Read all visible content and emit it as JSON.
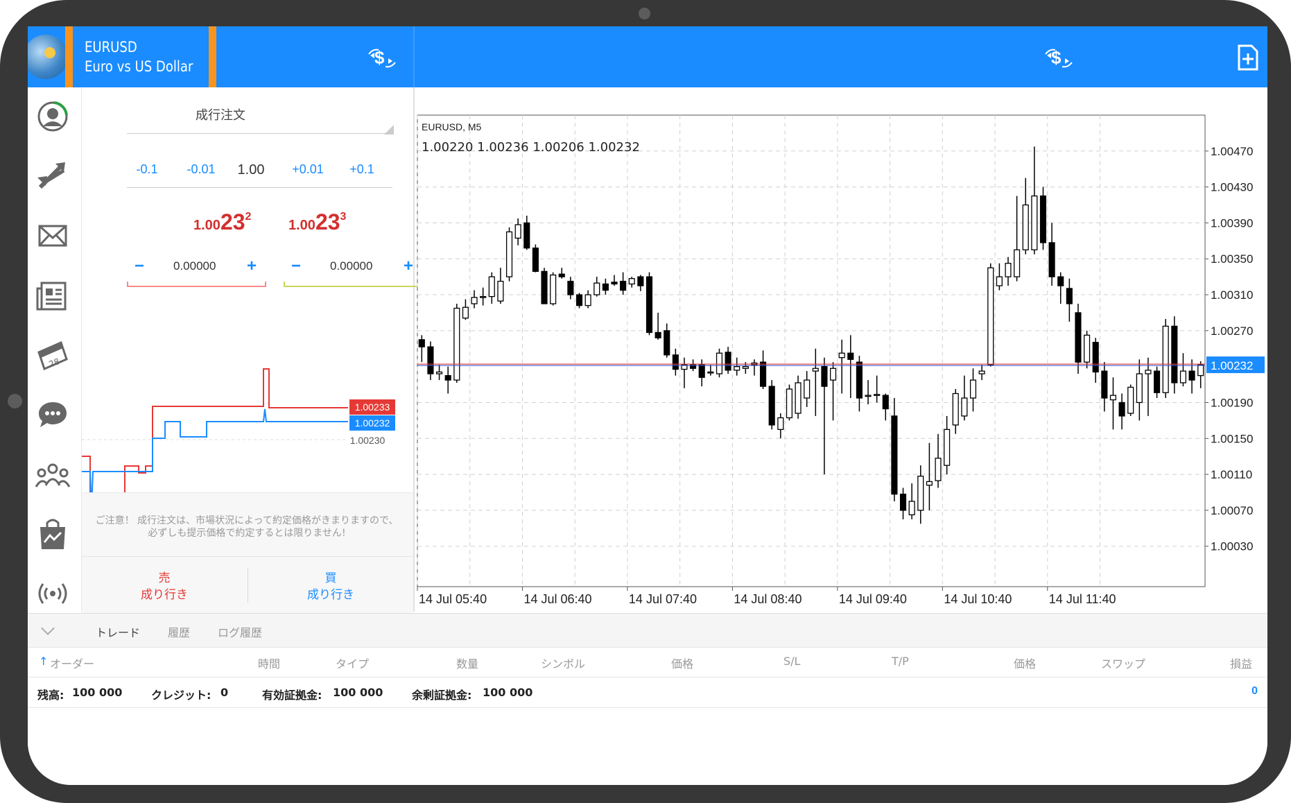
{
  "header": {
    "symbol": "EURUSD",
    "description": "Euro vs US Dollar",
    "icons": [
      "metatrader-app-icon",
      "currency-exchange-icon",
      "currency-exchange-icon",
      "new-order-icon"
    ]
  },
  "sidebar": {
    "items": [
      {
        "icon": "account-icon"
      },
      {
        "icon": "trade-arrows-icon"
      },
      {
        "icon": "mail-icon"
      },
      {
        "icon": "news-icon"
      },
      {
        "icon": "calendar-icon"
      },
      {
        "icon": "chat-icon"
      },
      {
        "icon": "community-icon"
      },
      {
        "icon": "market-bag-icon"
      },
      {
        "icon": "signal-icon"
      }
    ]
  },
  "order": {
    "type": "成行注文",
    "lot_steps": [
      "-0.1",
      "-0.01",
      "1.00",
      "+0.01",
      "+0.1"
    ],
    "bid": {
      "prefix": "1.00",
      "big": "23",
      "sup": "2"
    },
    "ask": {
      "prefix": "1.00",
      "big": "23",
      "sup": "3"
    },
    "stop_loss": {
      "minus": "−",
      "value": "0.00000",
      "plus": "+"
    },
    "take_profit": {
      "minus": "−",
      "value": "0.00000",
      "plus": "+"
    },
    "mini_chart": {
      "ask_label": "1.00233",
      "bid_label": "1.00232",
      "grid_label": "1.00230"
    },
    "notice": "ご注意！ 成行注文は、市場状況によって約定価格がきまりますので、必ずしも提示価格で約定するとは限りません!",
    "sell": {
      "line1": "売",
      "line2": "成り行き"
    },
    "buy": {
      "line1": "買",
      "line2": "成り行き"
    }
  },
  "chart_data": {
    "type": "candlestick",
    "symbol_label": "EURUSD, M5",
    "ohlc_label": "1.00220 1.00236 1.00206 1.00232",
    "current_price": "1.00232",
    "y_ticks": [
      "1.00470",
      "1.00430",
      "1.00390",
      "1.00350",
      "1.00310",
      "1.00270",
      "1.00190",
      "1.00150",
      "1.00110",
      "1.00070",
      "1.00030"
    ],
    "x_ticks": [
      "14 Jul 05:40",
      "14 Jul 06:40",
      "14 Jul 07:40",
      "14 Jul 08:40",
      "14 Jul 09:40",
      "14 Jul 10:40",
      "14 Jul 11:40"
    ],
    "ylim": [
      0.99985,
      1.0051
    ],
    "grid": true,
    "candles": [
      [
        1.0026,
        1.00265,
        1.00235,
        1.00252
      ],
      [
        1.00252,
        1.00258,
        1.00215,
        1.00222
      ],
      [
        1.00222,
        1.00232,
        1.00215,
        1.00224
      ],
      [
        1.0022,
        1.0023,
        1.002,
        1.00215
      ],
      [
        1.00215,
        1.003,
        1.00212,
        1.00295
      ],
      [
        1.00284,
        1.00305,
        1.00282,
        1.00296
      ],
      [
        1.003,
        1.00315,
        1.00295,
        1.00307
      ],
      [
        1.00308,
        1.00318,
        1.00298,
        1.00308
      ],
      [
        1.00308,
        1.00335,
        1.003,
        1.0033
      ],
      [
        1.00303,
        1.0034,
        1.003,
        1.00325
      ],
      [
        1.0033,
        1.00385,
        1.00325,
        1.0038
      ],
      [
        1.00373,
        1.00395,
        1.00365,
        1.00388
      ],
      [
        1.0039,
        1.00398,
        1.0036,
        1.00362
      ],
      [
        1.00362,
        1.00366,
        1.00335,
        1.00336
      ],
      [
        1.00336,
        1.0034,
        1.003,
        1.003
      ],
      [
        1.003,
        1.00335,
        1.00298,
        1.00332
      ],
      [
        1.00333,
        1.0034,
        1.00328,
        1.0033
      ],
      [
        1.00325,
        1.0033,
        1.00305,
        1.0031
      ],
      [
        1.0031,
        1.00312,
        1.00295,
        1.00298
      ],
      [
        1.00298,
        1.00315,
        1.00295,
        1.0031
      ],
      [
        1.0031,
        1.0033,
        1.00308,
        1.00323
      ],
      [
        1.00322,
        1.00328,
        1.0031,
        1.00315
      ],
      [
        1.00324,
        1.00332,
        1.0032,
        1.00322
      ],
      [
        1.00325,
        1.00335,
        1.0031,
        1.00315
      ],
      [
        1.00322,
        1.0033,
        1.00318,
        1.00328
      ],
      [
        1.0033,
        1.00332,
        1.00314,
        1.0032
      ],
      [
        1.0033,
        1.00335,
        1.00265,
        1.00268
      ],
      [
        1.00268,
        1.0029,
        1.0026,
        1.00262
      ],
      [
        1.0027,
        1.00278,
        1.0024,
        1.00243
      ],
      [
        1.00243,
        1.0025,
        1.0022,
        1.00227
      ],
      [
        1.00227,
        1.0024,
        1.00206,
        1.00232
      ],
      [
        1.00232,
        1.00238,
        1.00225,
        1.00228
      ],
      [
        1.00232,
        1.00238,
        1.00208,
        1.00218
      ],
      [
        1.00223,
        1.00232,
        1.0022,
        1.00224
      ],
      [
        1.00222,
        1.0025,
        1.00218,
        1.00245
      ],
      [
        1.00246,
        1.00252,
        1.00222,
        1.00226
      ],
      [
        1.00226,
        1.0024,
        1.0022,
        1.0023
      ],
      [
        1.00228,
        1.00235,
        1.00222,
        1.0023
      ],
      [
        1.00232,
        1.00238,
        1.0022,
        1.00234
      ],
      [
        1.00235,
        1.00248,
        1.00205,
        1.00208
      ],
      [
        1.00208,
        1.00215,
        1.0016,
        1.00165
      ],
      [
        1.0016,
        1.00178,
        1.0015,
        1.00173
      ],
      [
        1.00173,
        1.0021,
        1.0017,
        1.00205
      ],
      [
        1.00178,
        1.0022,
        1.00172,
        1.00212
      ],
      [
        1.00195,
        1.00225,
        1.00185,
        1.00215
      ],
      [
        1.00225,
        1.0025,
        1.00175,
        1.00228
      ],
      [
        1.0023,
        1.0024,
        1.0011,
        1.00208
      ],
      [
        1.00215,
        1.00235,
        1.0017,
        1.00228
      ],
      [
        1.0024,
        1.0026,
        1.002,
        1.00245
      ],
      [
        1.00245,
        1.00265,
        1.00195,
        1.00238
      ],
      [
        1.00235,
        1.00242,
        1.0018,
        1.00195
      ],
      [
        1.00198,
        1.00215,
        1.00188,
        1.00198
      ],
      [
        1.00198,
        1.0022,
        1.0019,
        1.00199
      ],
      [
        1.00198,
        1.002,
        1.0017,
        1.00183
      ],
      [
        1.00175,
        1.00195,
        1.0008,
        1.00088
      ],
      [
        1.00088,
        1.00095,
        1.0006,
        1.0007
      ],
      [
        1.00065,
        1.001,
        1.0006,
        1.0008
      ],
      [
        1.0007,
        1.0012,
        1.00055,
        1.00108
      ],
      [
        1.00098,
        1.00145,
        1.0007,
        1.00102
      ],
      [
        1.00103,
        1.00155,
        1.00095,
        1.00128
      ],
      [
        1.0012,
        1.00175,
        1.0011,
        1.0016
      ],
      [
        1.00165,
        1.00205,
        1.00155,
        1.002
      ],
      [
        1.00175,
        1.0022,
        1.0017,
        1.00195
      ],
      [
        1.00195,
        1.00228,
        1.0018,
        1.00215
      ],
      [
        1.00222,
        1.00232,
        1.00215,
        1.00225
      ],
      [
        1.00232,
        1.00345,
        1.0023,
        1.0034
      ],
      [
        1.0032,
        1.00345,
        1.00315,
        1.0033
      ],
      [
        1.0033,
        1.00352,
        1.0032,
        1.00345
      ],
      [
        1.0033,
        1.0042,
        1.00325,
        1.0036
      ],
      [
        1.0036,
        1.0044,
        1.00355,
        1.0041
      ],
      [
        1.0036,
        1.00475,
        1.00355,
        1.0042
      ],
      [
        1.0042,
        1.0043,
        1.0036,
        1.00368
      ],
      [
        1.00368,
        1.0039,
        1.0032,
        1.0033
      ],
      [
        1.0033,
        1.00335,
        1.003,
        1.0032
      ],
      [
        1.00317,
        1.00328,
        1.0028,
        1.003
      ],
      [
        1.0029,
        1.003,
        1.00222,
        1.00235
      ],
      [
        1.00235,
        1.0027,
        1.00228,
        1.00265
      ],
      [
        1.00257,
        1.00262,
        1.00212,
        1.00224
      ],
      [
        1.00225,
        1.00235,
        1.0018,
        1.00195
      ],
      [
        1.00193,
        1.00218,
        1.0016,
        1.00198
      ],
      [
        1.0019,
        1.002,
        1.0016,
        1.00175
      ],
      [
        1.00178,
        1.0021,
        1.00175,
        1.00207
      ],
      [
        1.0019,
        1.00238,
        1.0017,
        1.00222
      ],
      [
        1.00222,
        1.0024,
        1.00175,
        1.00226
      ],
      [
        1.00225,
        1.0023,
        1.00195,
        1.00201
      ],
      [
        1.00201,
        1.00283,
        1.00195,
        1.00275
      ],
      [
        1.00275,
        1.00286,
        1.002,
        1.00212
      ],
      [
        1.00212,
        1.00245,
        1.00208,
        1.00225
      ],
      [
        1.00225,
        1.00238,
        1.002,
        1.00215
      ],
      [
        1.0022,
        1.00236,
        1.00206,
        1.00232
      ]
    ]
  },
  "bottom": {
    "tabs": [
      "トレード",
      "履歴",
      "ログ履歴"
    ],
    "columns": [
      "オーダー",
      "時間",
      "タイプ",
      "数量",
      "シンボル",
      "価格",
      "S/L",
      "T/P",
      "価格",
      "スワップ",
      "損益"
    ],
    "summary": [
      {
        "label": "残高:",
        "value": "100 000"
      },
      {
        "label": "クレジット:",
        "value": "0"
      },
      {
        "label": "有効証拠金:",
        "value": "100 000"
      },
      {
        "label": "余剰証拠金:",
        "value": "100 000"
      }
    ],
    "profit": "0"
  }
}
